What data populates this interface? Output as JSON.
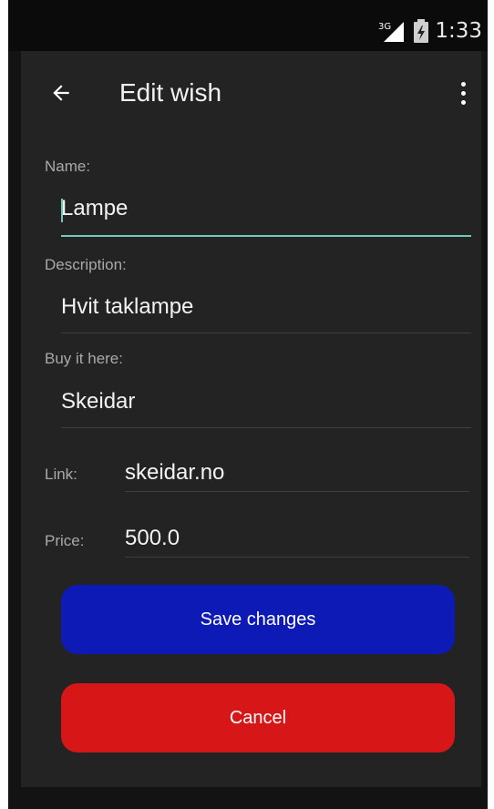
{
  "status_bar": {
    "network_label": "3G",
    "time": "1:33"
  },
  "toolbar": {
    "title": "Edit wish",
    "back_icon": "arrow-left-icon",
    "menu_icon": "more-vert-icon"
  },
  "form": {
    "name": {
      "label": "Name:",
      "value": "Lampe"
    },
    "description": {
      "label": "Description:",
      "value": "Hvit taklampe"
    },
    "buy_it_here": {
      "label": "Buy it here:",
      "value": "Skeidar"
    },
    "link": {
      "label": "Link:",
      "value": "skeidar.no"
    },
    "price": {
      "label": "Price:",
      "value": "500.0"
    }
  },
  "buttons": {
    "save_label": "Save changes",
    "cancel_label": "Cancel",
    "save_color": "#0e1ab6",
    "cancel_color": "#d71717"
  },
  "colors": {
    "accent": "#73c8b8",
    "background": "#232323"
  }
}
